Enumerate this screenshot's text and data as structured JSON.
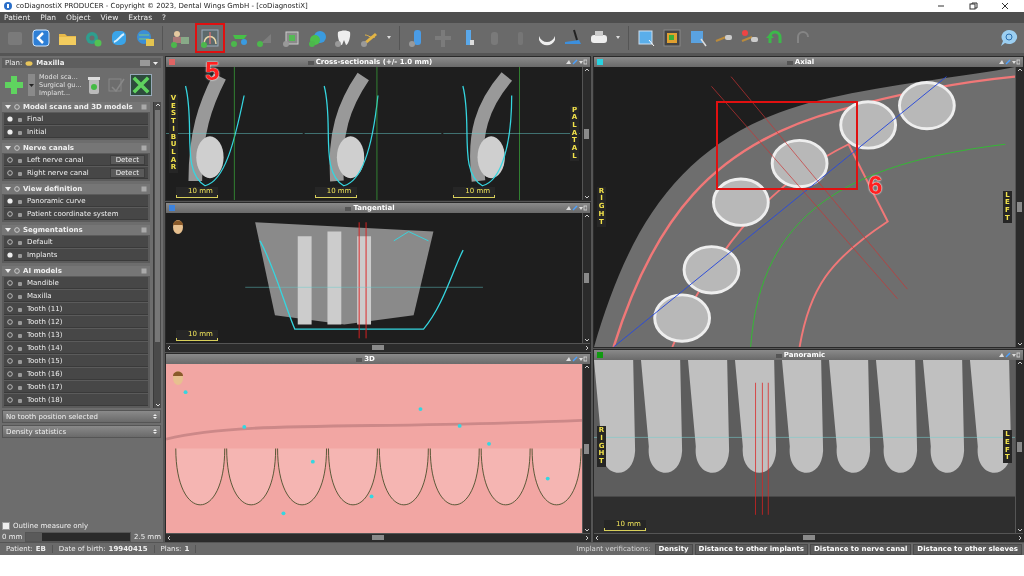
{
  "window": {
    "title": "coDiagnostiX PRODUCER - Copyright © 2023, Dental Wings GmbH - [coDiagnostiX]"
  },
  "menu": [
    {
      "label": "Patient"
    },
    {
      "label": "Plan"
    },
    {
      "label": "Object"
    },
    {
      "label": "View"
    },
    {
      "label": "Extras"
    },
    {
      "label": "?"
    }
  ],
  "annotations": [
    {
      "label": "5"
    },
    {
      "label": "6"
    }
  ],
  "plan": {
    "label": "Plan:",
    "name": "Maxilla",
    "add_menu": [
      "Model sca...",
      "Surgical gu...",
      "Implant..."
    ]
  },
  "sections": [
    {
      "title": "Model scans and 3D models",
      "expanded": true,
      "items": [
        {
          "name": "Final",
          "visible": true
        },
        {
          "name": "Initial",
          "visible": true
        }
      ]
    },
    {
      "title": "Nerve canals",
      "expanded": true,
      "items": [
        {
          "name": "Left nerve canal",
          "visible": false,
          "action": "Detect"
        },
        {
          "name": "Right nerve canal",
          "visible": false,
          "action": "Detect"
        }
      ]
    },
    {
      "title": "View definition",
      "expanded": true,
      "items": [
        {
          "name": "Panoramic curve",
          "visible": true
        },
        {
          "name": "Patient coordinate system",
          "visible": false
        }
      ]
    },
    {
      "title": "Segmentations",
      "expanded": true,
      "items": [
        {
          "name": "Default",
          "visible": false
        },
        {
          "name": "Implants",
          "visible": true
        }
      ]
    },
    {
      "title": "AI models",
      "expanded": true,
      "items": [
        {
          "name": "Mandible",
          "visible": false
        },
        {
          "name": "Maxilla",
          "visible": false
        },
        {
          "name": "Tooth (11)",
          "visible": false
        },
        {
          "name": "Tooth (12)",
          "visible": false
        },
        {
          "name": "Tooth (13)",
          "visible": false
        },
        {
          "name": "Tooth (14)",
          "visible": false
        },
        {
          "name": "Tooth (15)",
          "visible": false
        },
        {
          "name": "Tooth (16)",
          "visible": false
        },
        {
          "name": "Tooth (17)",
          "visible": false
        },
        {
          "name": "Tooth (18)",
          "visible": false
        }
      ]
    }
  ],
  "selectors": [
    "No tooth position selected",
    "Density statistics"
  ],
  "outline_measure": {
    "label": "Outline measure only",
    "checked": false
  },
  "threshold": {
    "min": "0 mm",
    "max": "2.5 mm",
    "level": 0.15
  },
  "views": {
    "left": [
      {
        "kind": "cross",
        "title": "Cross-sectionals (+/- 1.0 mm)",
        "color": "#e06464",
        "scales": [
          "10 mm",
          "10 mm",
          "10 mm"
        ],
        "orientation": [
          "VESTIBULAR",
          "PALATAL"
        ]
      },
      {
        "kind": "tangential",
        "title": "Tangential",
        "color": "#3c82dc",
        "scales": [
          "10 mm"
        ]
      },
      {
        "kind": "volume",
        "title": "3D"
      }
    ],
    "right": [
      {
        "kind": "axial",
        "title": "Axial",
        "color": "#28d2e0",
        "orientation": [
          "RIGHT",
          "LEFT"
        ]
      },
      {
        "kind": "panoramic",
        "title": "Panoramic",
        "color": "#109a10",
        "scales": [
          "10 mm"
        ],
        "orientation": [
          "RIGHT",
          "LEFT"
        ]
      }
    ]
  },
  "status_bar": {
    "fields": [
      {
        "label": "Patient:",
        "value": "EB"
      },
      {
        "label": "Date of birth:",
        "value": "19940415"
      },
      {
        "label": "Plans:",
        "value": "1"
      }
    ],
    "verifications_label": "Implant verifications:",
    "verifications": [
      "Density",
      "Distance to other implants",
      "Distance to nerve canal",
      "Distance to other sleeves"
    ]
  }
}
